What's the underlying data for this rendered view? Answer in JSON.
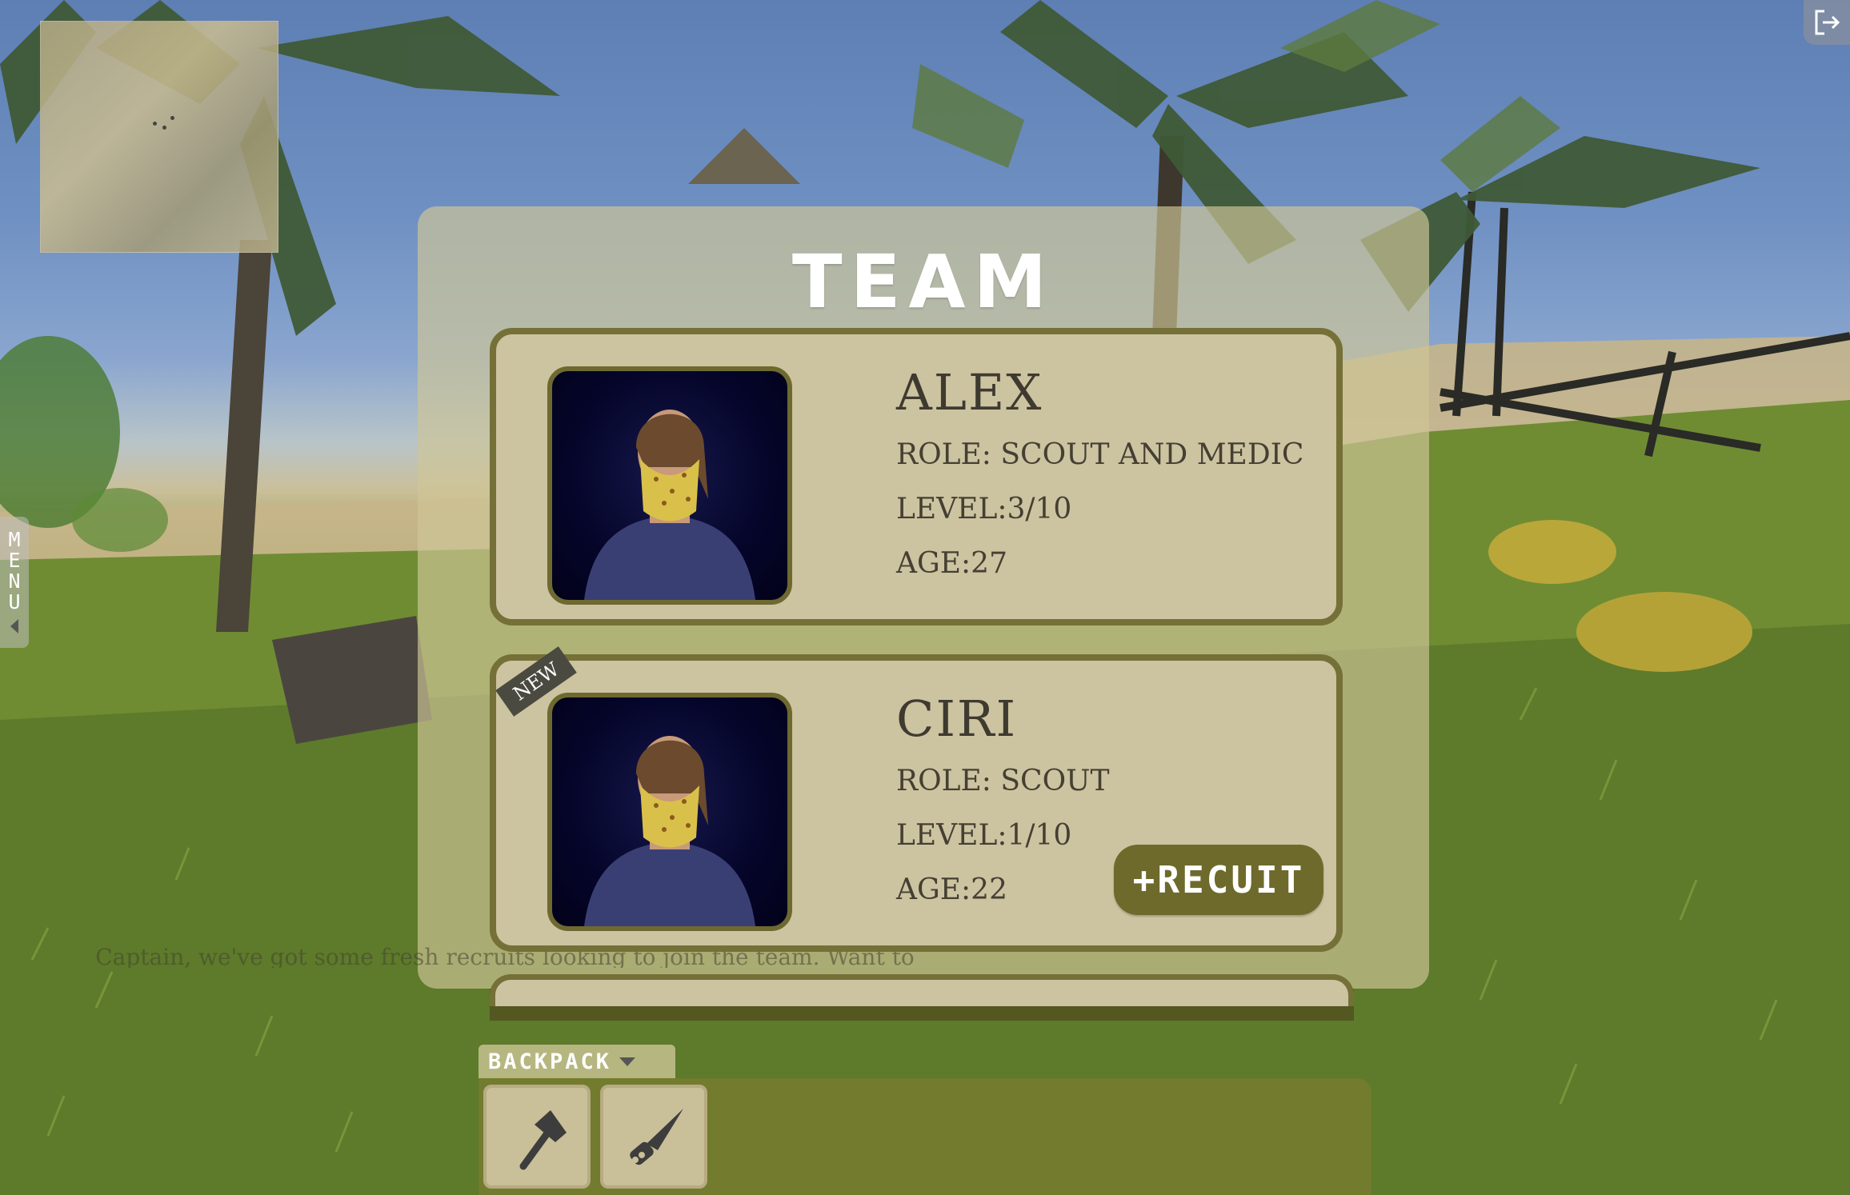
{
  "team_panel": {
    "title": "TEAM",
    "members": [
      {
        "name": "ALEX",
        "role": "ROLE: SCOUT AND MEDIC",
        "level": "LEVEL:3/10",
        "age": "AGE:27",
        "is_new": false
      },
      {
        "name": "CIRI",
        "role": "ROLE: SCOUT",
        "level": "LEVEL:1/10",
        "age": "AGE:22",
        "is_new": true,
        "badge": "NEW",
        "action_label": "+RECUIT"
      }
    ],
    "partial_message": "Captain, we've got some fresh recruits looking to join the team. Want to meet them and"
  },
  "side_menu": {
    "label": "MENU"
  },
  "backpack": {
    "label": "BACKPACK",
    "slots": [
      {
        "item": "axe-icon"
      },
      {
        "item": "knife-icon"
      }
    ]
  },
  "colors": {
    "panel": "#cec696",
    "card": "#ccc3a0",
    "card_border": "#757037",
    "button": "#6e6a2c",
    "text": "#3f3a30"
  }
}
